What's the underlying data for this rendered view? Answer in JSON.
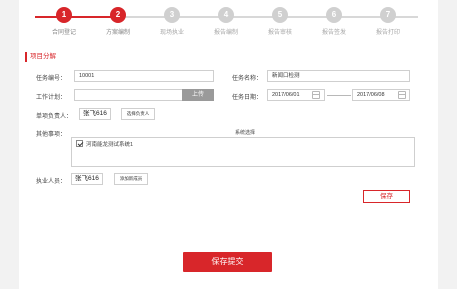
{
  "steps": [
    {
      "num": "1",
      "label": "合同登记"
    },
    {
      "num": "2",
      "label": "方案编制"
    },
    {
      "num": "3",
      "label": "现场执业"
    },
    {
      "num": "4",
      "label": "报告编制"
    },
    {
      "num": "5",
      "label": "报告审核"
    },
    {
      "num": "6",
      "label": "报告签发"
    },
    {
      "num": "7",
      "label": "报告打印"
    }
  ],
  "current_step": 2,
  "section_title": "项目分解",
  "form": {
    "task_no_label": "任务编号：",
    "task_no_value": "10001",
    "task_name_label": "任务名称：",
    "task_name_value": "新闻口检测",
    "work_plan_label": "工作计划：",
    "work_plan_value": "",
    "upload_label": "上传",
    "task_date_label": "任务日期：",
    "date_start": "2017/06/01",
    "date_end": "2017/06/08",
    "leader_label": "单项负责人：",
    "leader_value": "张飞616",
    "select_leader_label": "选择负责人",
    "other_label": "其他事项：",
    "system_select_label": "系统选择",
    "system_option_label": "河南能龙测试系统1",
    "system_option_checked": true,
    "staff_label": "执业人员：",
    "staff_value": "张飞616",
    "add_staff_label": "添加新成员",
    "save_label": "保存"
  },
  "submit_label": "保存提交",
  "colors": {
    "accent": "#d8262a",
    "inactive": "#d0d0d0",
    "background": "#f2f2f2"
  }
}
